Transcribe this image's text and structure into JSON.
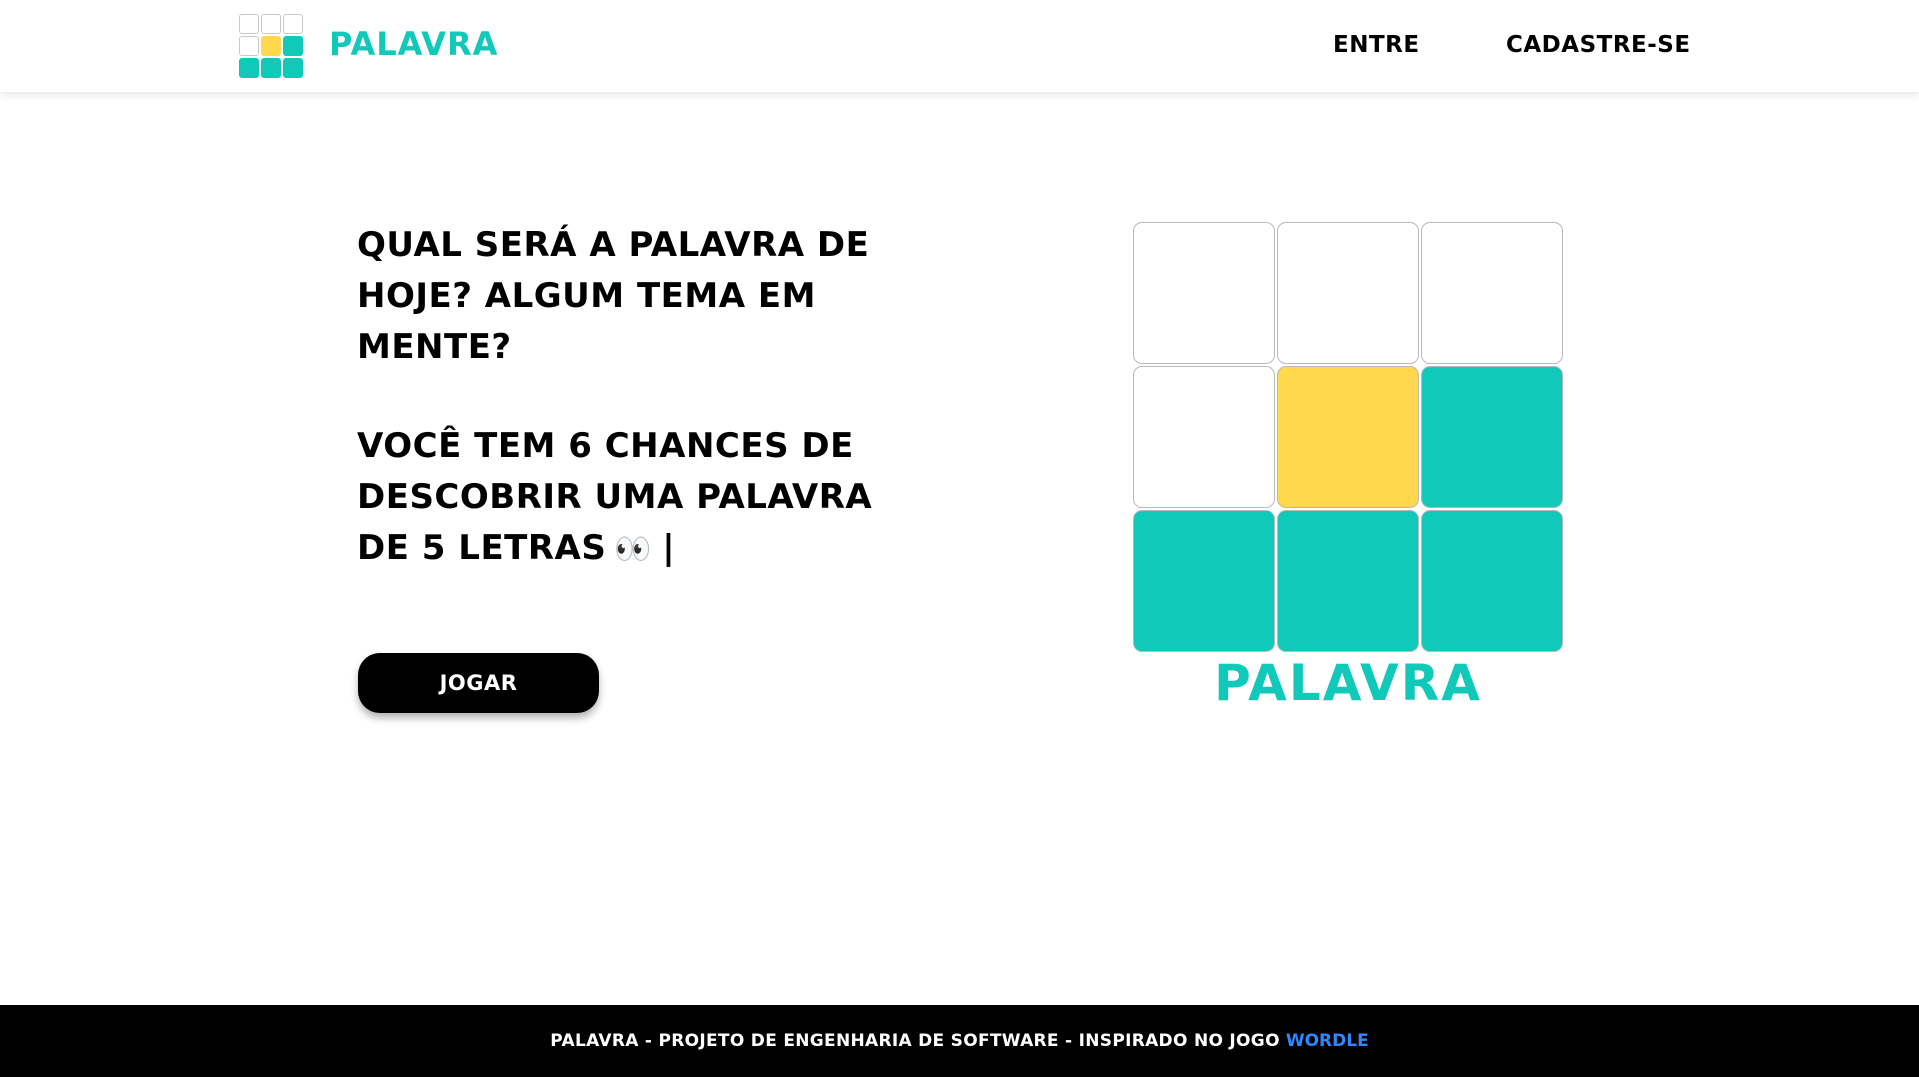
{
  "header": {
    "logo_text": "PALAVRA",
    "nav": {
      "login": "ENTRE",
      "signup": "CADASTRE-SE"
    }
  },
  "hero": {
    "title": "QUAL SERÁ A PALAVRA DE HOJE? ALGUM TEMA EM MENTE?",
    "subtitle": "VOCÊ TEM 6 CHANCES DE DESCOBRIR UMA PALAVRA DE 5 LETRAS",
    "emoji": "👀",
    "cursor": "|",
    "play_button": "JOGAR"
  },
  "illustration": {
    "word": "PALAVRA",
    "tiles": [
      "empty",
      "empty",
      "empty",
      "empty",
      "yellow",
      "teal",
      "teal",
      "teal",
      "teal"
    ]
  },
  "colors": {
    "accent_teal": "#10c9b8",
    "accent_yellow": "#ffd84d",
    "link_blue": "#2f86ff"
  },
  "footer": {
    "text": "PALAVRA - PROJETO DE ENGENHARIA DE SOFTWARE - INSPIRADO NO JOGO",
    "link": "WORDLE"
  }
}
